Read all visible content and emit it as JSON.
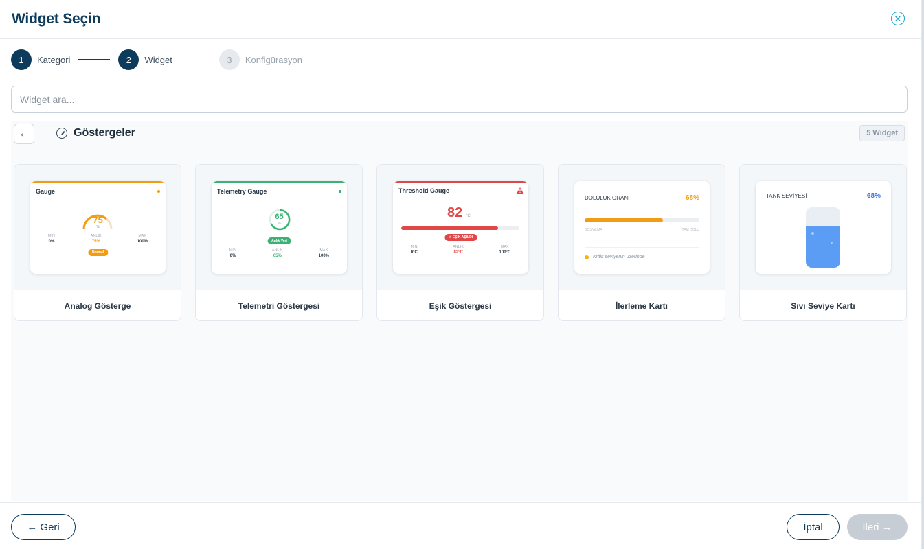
{
  "modal": {
    "title": "Widget Seçin",
    "close_icon": "close-circle-icon"
  },
  "stepper": {
    "steps": [
      {
        "num": "1",
        "label": "Kategori",
        "state": "done"
      },
      {
        "num": "2",
        "label": "Widget",
        "state": "active"
      },
      {
        "num": "3",
        "label": "Konfigürasyon",
        "state": "inactive"
      }
    ]
  },
  "search": {
    "placeholder": "Widget ara...",
    "value": ""
  },
  "category": {
    "back_icon": "arrow-left-icon",
    "icon": "gauge-icon",
    "title": "Göstergeler",
    "count": "5 Widget"
  },
  "colors": {
    "primary": "#0d3b5c",
    "orange": "#f39c12",
    "green": "#3bb273",
    "red": "#e04848",
    "blue": "#2f6fe0"
  },
  "widgets": [
    {
      "name": "Analog Gösterge",
      "preview": {
        "title": "Gauge",
        "value": "75",
        "unit": "%",
        "min_k": "MIN",
        "min_v": "0%",
        "cur_k": "ANLIK",
        "cur_v": "75%",
        "max_k": "MAX",
        "max_v": "100%",
        "pill": "Normal"
      }
    },
    {
      "name": "Telemetri Göstergesi",
      "preview": {
        "title": "Telemetry Gauge",
        "value": "65",
        "unit": "%",
        "pill": "Anlık Veri",
        "min_k": "MIN",
        "min_v": "0%",
        "cur_k": "ANLIK",
        "cur_v": "65%",
        "max_k": "MAX",
        "max_v": "100%"
      }
    },
    {
      "name": "Eşik Göstergesi",
      "preview": {
        "title": "Threshold Gauge",
        "value": "82",
        "unit": "°C",
        "pill": "EŞİK AŞILDI",
        "min_k": "MIN",
        "min_v": "0°C",
        "cur_k": "ANLIK",
        "cur_v": "82°C",
        "max_k": "MAX",
        "max_v": "100°C"
      }
    },
    {
      "name": "İlerleme Kartı",
      "preview": {
        "title": "DOLULUK ORANI",
        "value": "68%",
        "left_label": "BOŞ/ALMA",
        "right_label": "TAM DOLU",
        "note": "Kritik seviyenin üzerinde"
      }
    },
    {
      "name": "Sıvı Seviye Kartı",
      "preview": {
        "title": "TANK SEVİYESİ",
        "value": "68%"
      }
    }
  ],
  "footer": {
    "back_label": "← Geri",
    "cancel_label": "İptal",
    "next_label": "İleri →"
  }
}
